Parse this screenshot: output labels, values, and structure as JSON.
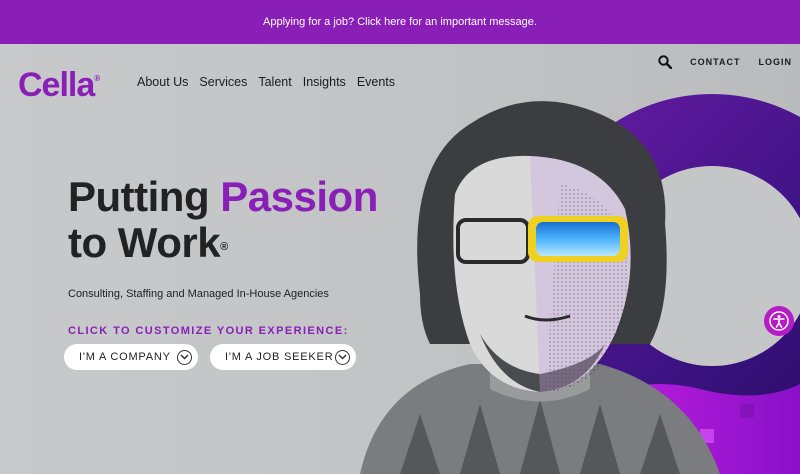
{
  "banner": {
    "message": "Applying for a job? Click here for an important message."
  },
  "header": {
    "logo_text": "Cella",
    "logo_mark": "®",
    "nav": [
      {
        "label": "About Us"
      },
      {
        "label": "Services"
      },
      {
        "label": "Talent"
      },
      {
        "label": "Insights"
      },
      {
        "label": "Events"
      }
    ],
    "utility": {
      "search_icon": "search-icon",
      "contact": "CONTACT",
      "login": "LOGIN"
    }
  },
  "hero": {
    "headline_part1": "Putting ",
    "headline_accent": "Passion",
    "headline_line2": "to Work",
    "headline_mark": "®",
    "subheading": "Consulting, Staffing and Managed In-House Agencies",
    "cta_label": "CLICK TO CUSTOMIZE YOUR EXPERIENCE:",
    "buttons": [
      {
        "label": "I'M A COMPANY",
        "icon": "chevron-down-icon"
      },
      {
        "label": "I'M A JOB SEEKER",
        "icon": "chevron-down-icon"
      }
    ]
  },
  "accessibility": {
    "icon": "accessibility-icon"
  },
  "colors": {
    "brand_purple": "#8a1fb8",
    "hero_bg": "#c4c6c8",
    "accessibility_magenta": "#b41cc5"
  }
}
